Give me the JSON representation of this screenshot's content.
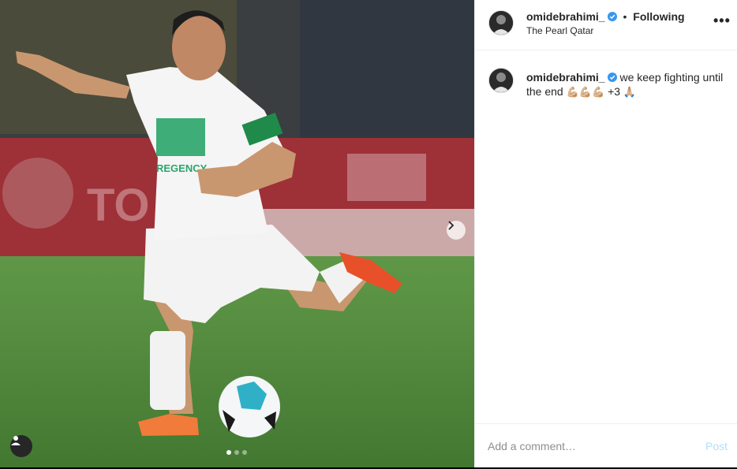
{
  "post": {
    "username": "omidebrahimi_",
    "follow_status": "Following",
    "separator": "•",
    "location": "The Pearl Qatar",
    "more_label": "•••",
    "caption_user": "omidebrahimi_",
    "caption_text": "we keep fighting until the end",
    "caption_emoji": "💪🏼💪🏼💪🏼",
    "caption_extra": "+3",
    "caption_emoji2": "🙏🏼",
    "carousel_count": 3,
    "carousel_active": 1
  },
  "comment": {
    "placeholder": "Add a comment…",
    "post_label": "Post"
  },
  "colors": {
    "verified": "#3897f0",
    "post_disabled": "#b2dffc",
    "text": "#262626",
    "muted": "#8e8e8e"
  },
  "icons": {
    "verified": "verified-badge-icon",
    "user_tag": "user-tag-icon",
    "next": "chevron-right-icon"
  }
}
